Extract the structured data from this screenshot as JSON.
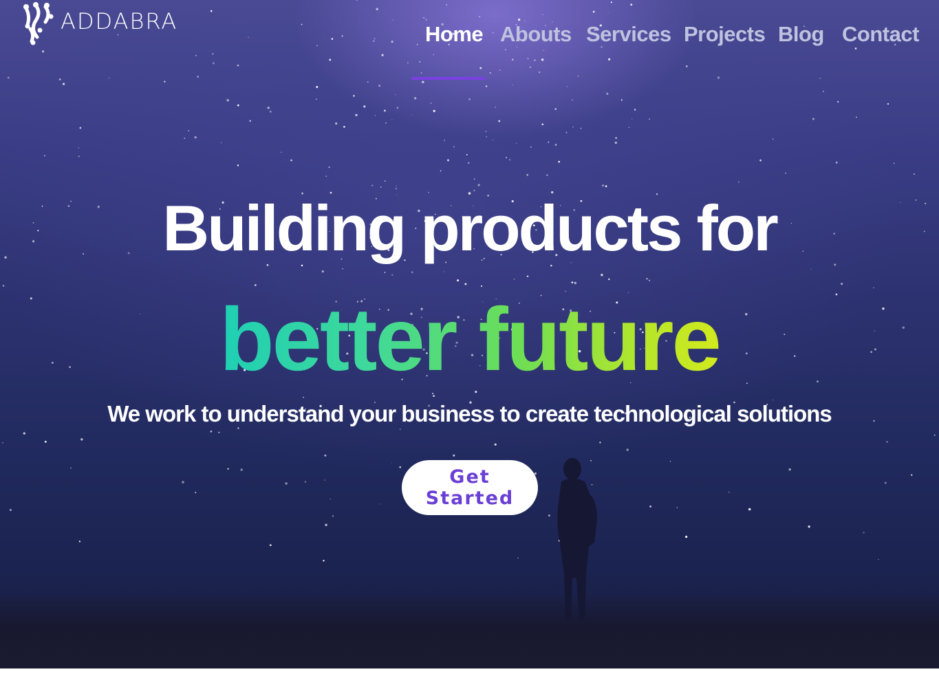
{
  "brand": {
    "name": "ADDABRA",
    "logo_icon": "addabra-logo-icon"
  },
  "nav": {
    "items": [
      {
        "label": "Home",
        "active": true
      },
      {
        "label": "Abouts",
        "active": false
      },
      {
        "label": "Services",
        "active": false
      },
      {
        "label": "Projects",
        "active": false
      },
      {
        "label": "Blog",
        "active": false
      },
      {
        "label": "Contact",
        "active": false
      }
    ],
    "active_color": "#7b3fe4"
  },
  "hero": {
    "headline": "Building products for",
    "headline_accent": "better future",
    "subtitle": "We work to understand your business to create technological solutions",
    "cta_label": "Get Started",
    "accent_gradient": [
      "#1fcfb4",
      "#d2ea1e"
    ],
    "cta_text_color": "#6a3fd6"
  }
}
